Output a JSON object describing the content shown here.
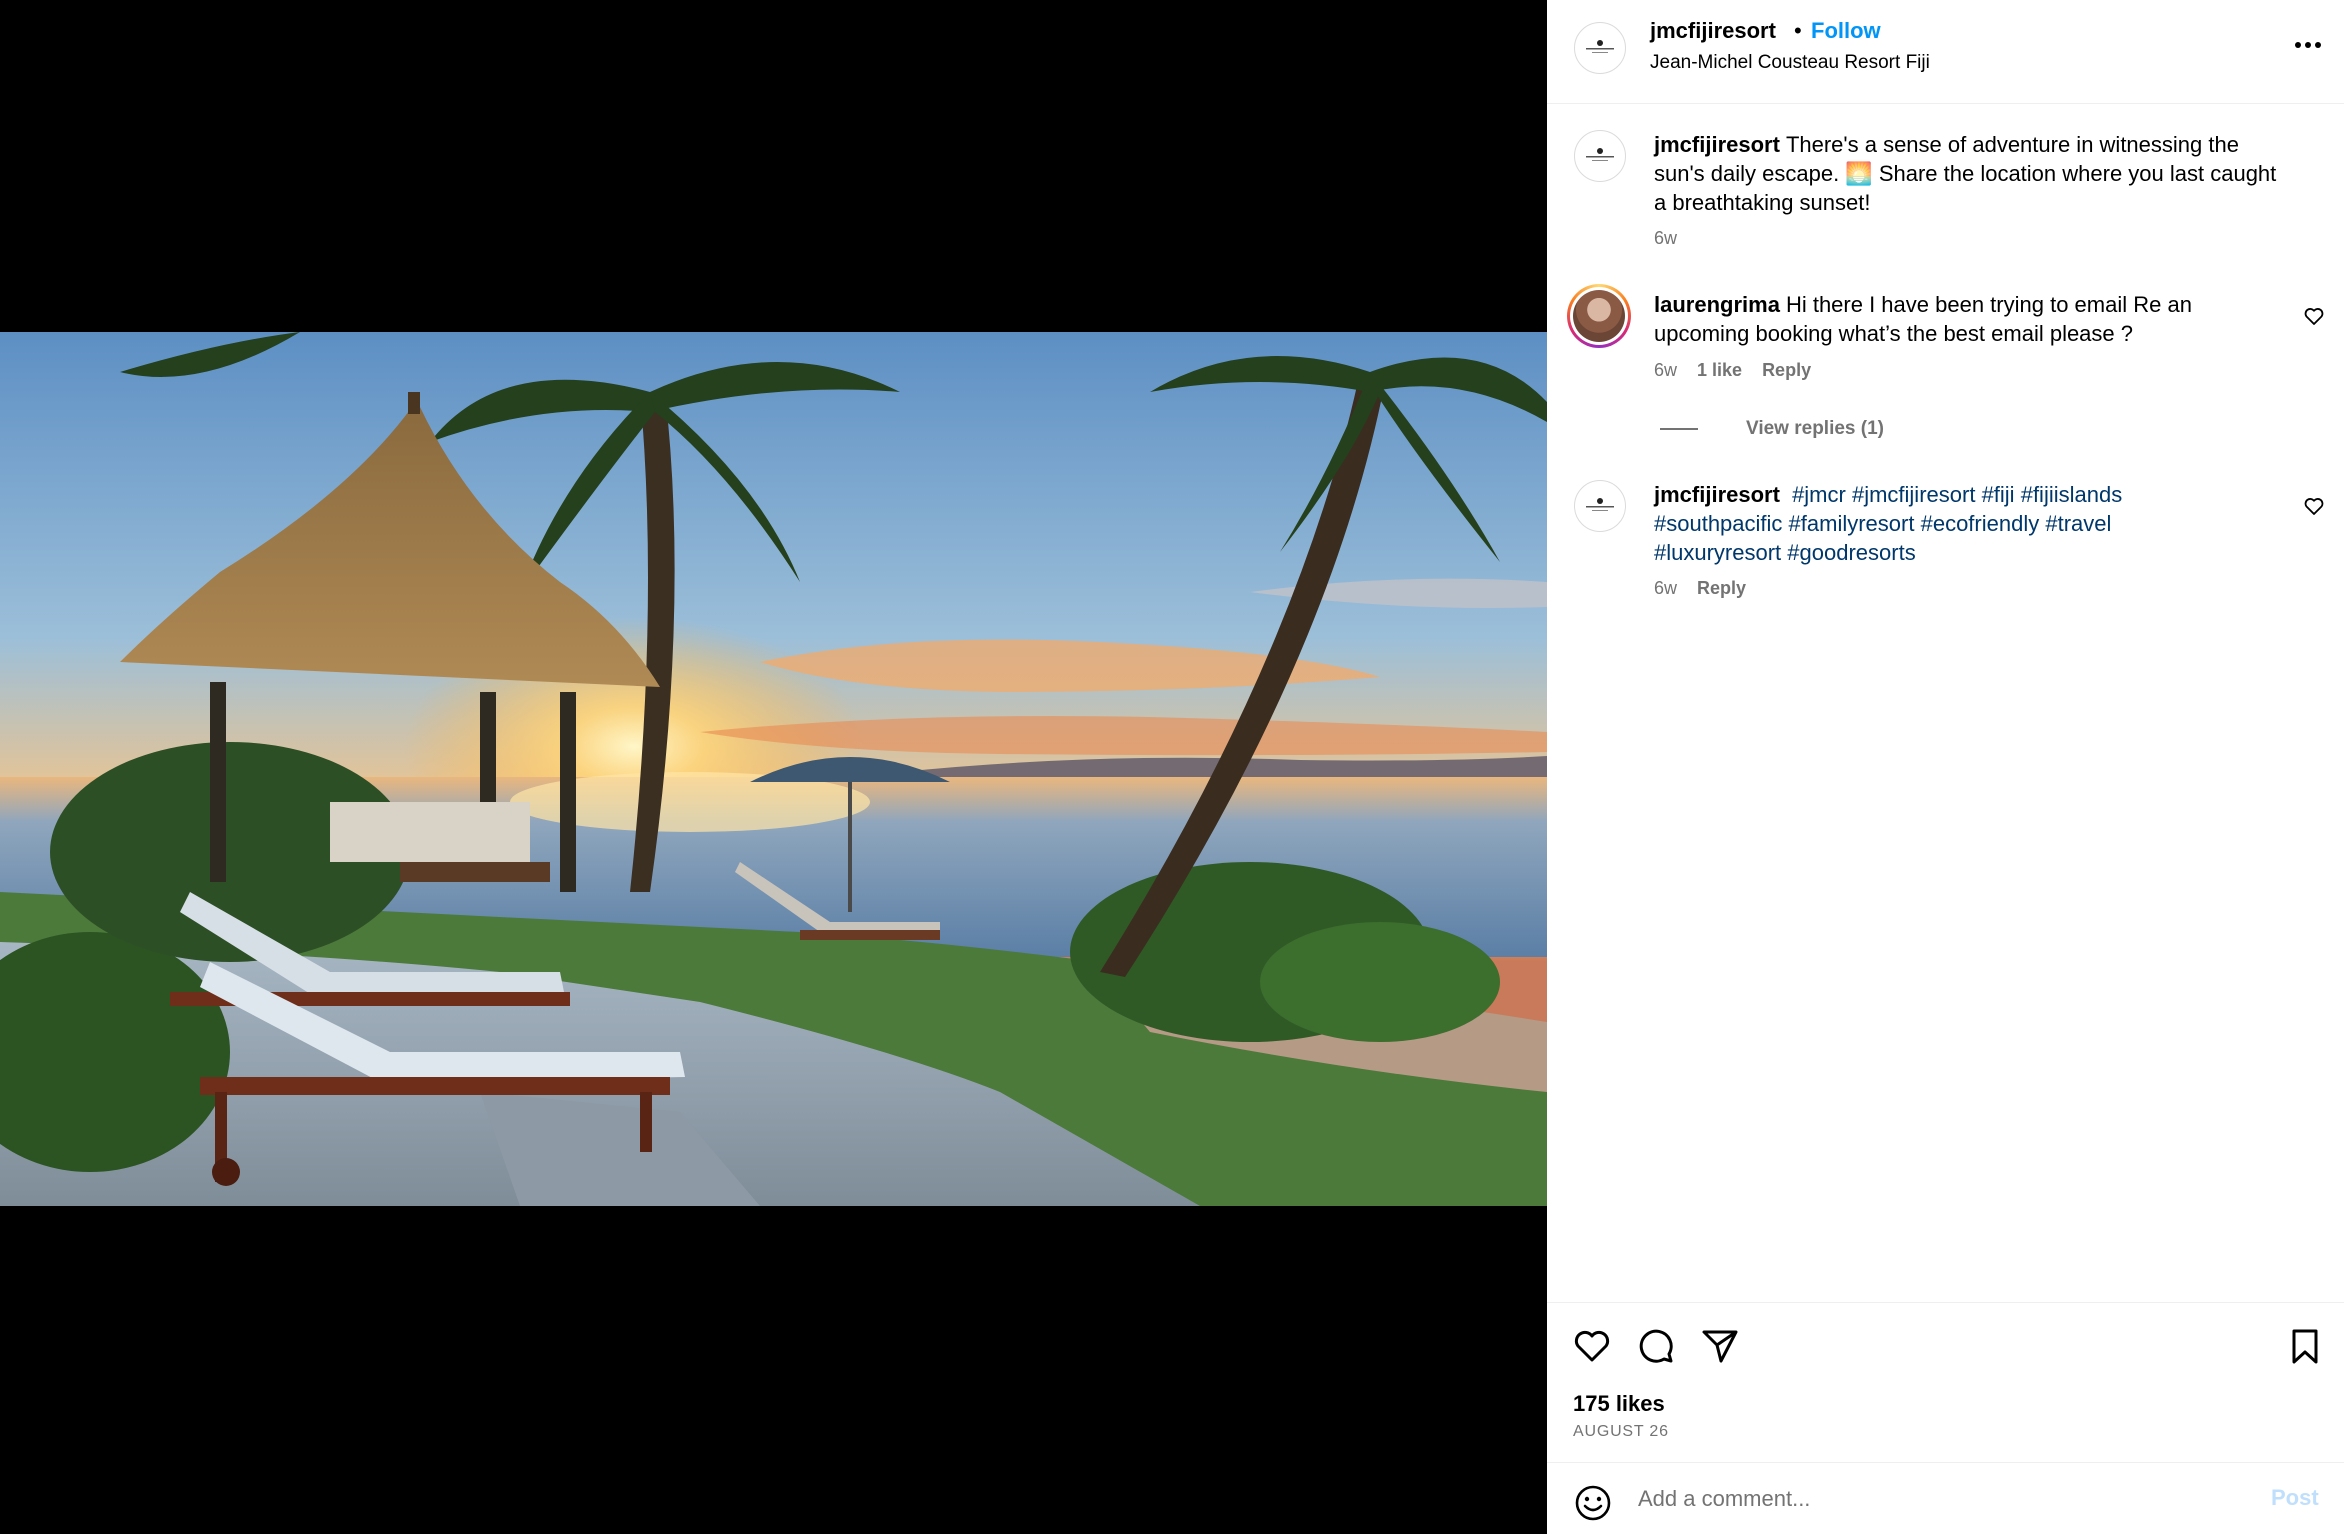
{
  "post": {
    "username": "jmcfijiresort",
    "separator": "•",
    "follow_label": "Follow",
    "location": "Jean-Michel Cousteau Resort Fiji",
    "more_icon": "more-horizontal-icon"
  },
  "comments": [
    {
      "username": "jmcfijiresort",
      "text": "There's a sense of adventure in witnessing the sun's daily escape. 🌅 Share the location where you last caught a breathtaking sunset!",
      "time": "6w"
    },
    {
      "username": "laurengrima",
      "text": "Hi there I have been trying to email Re an upcoming booking what’s the best email please ?",
      "time": "6w",
      "likes": "1 like",
      "reply_label": "Reply",
      "view_replies": "View replies (1)"
    },
    {
      "username": "jmcfijiresort",
      "hashtags": [
        "#jmcr",
        "#jmcfijiresort",
        "#fiji",
        "#fijiislands",
        "#southpacific",
        "#familyresort",
        "#ecofriendly",
        "#travel",
        "#luxuryresort",
        "#goodresorts"
      ],
      "time": "6w",
      "reply_label": "Reply"
    }
  ],
  "actions": {
    "icons": [
      "heart-icon",
      "comment-icon",
      "share-icon",
      "bookmark-icon"
    ],
    "likes": "175 likes",
    "date": "AUGUST 26"
  },
  "add_comment": {
    "placeholder": "Add a comment...",
    "post_label": "Post",
    "emoji_icon": "emoji-icon"
  },
  "colors": {
    "link_blue": "#0095f6",
    "hashtag": "#00376b",
    "muted": "#737373",
    "post_disabled": "#c0dffd"
  }
}
